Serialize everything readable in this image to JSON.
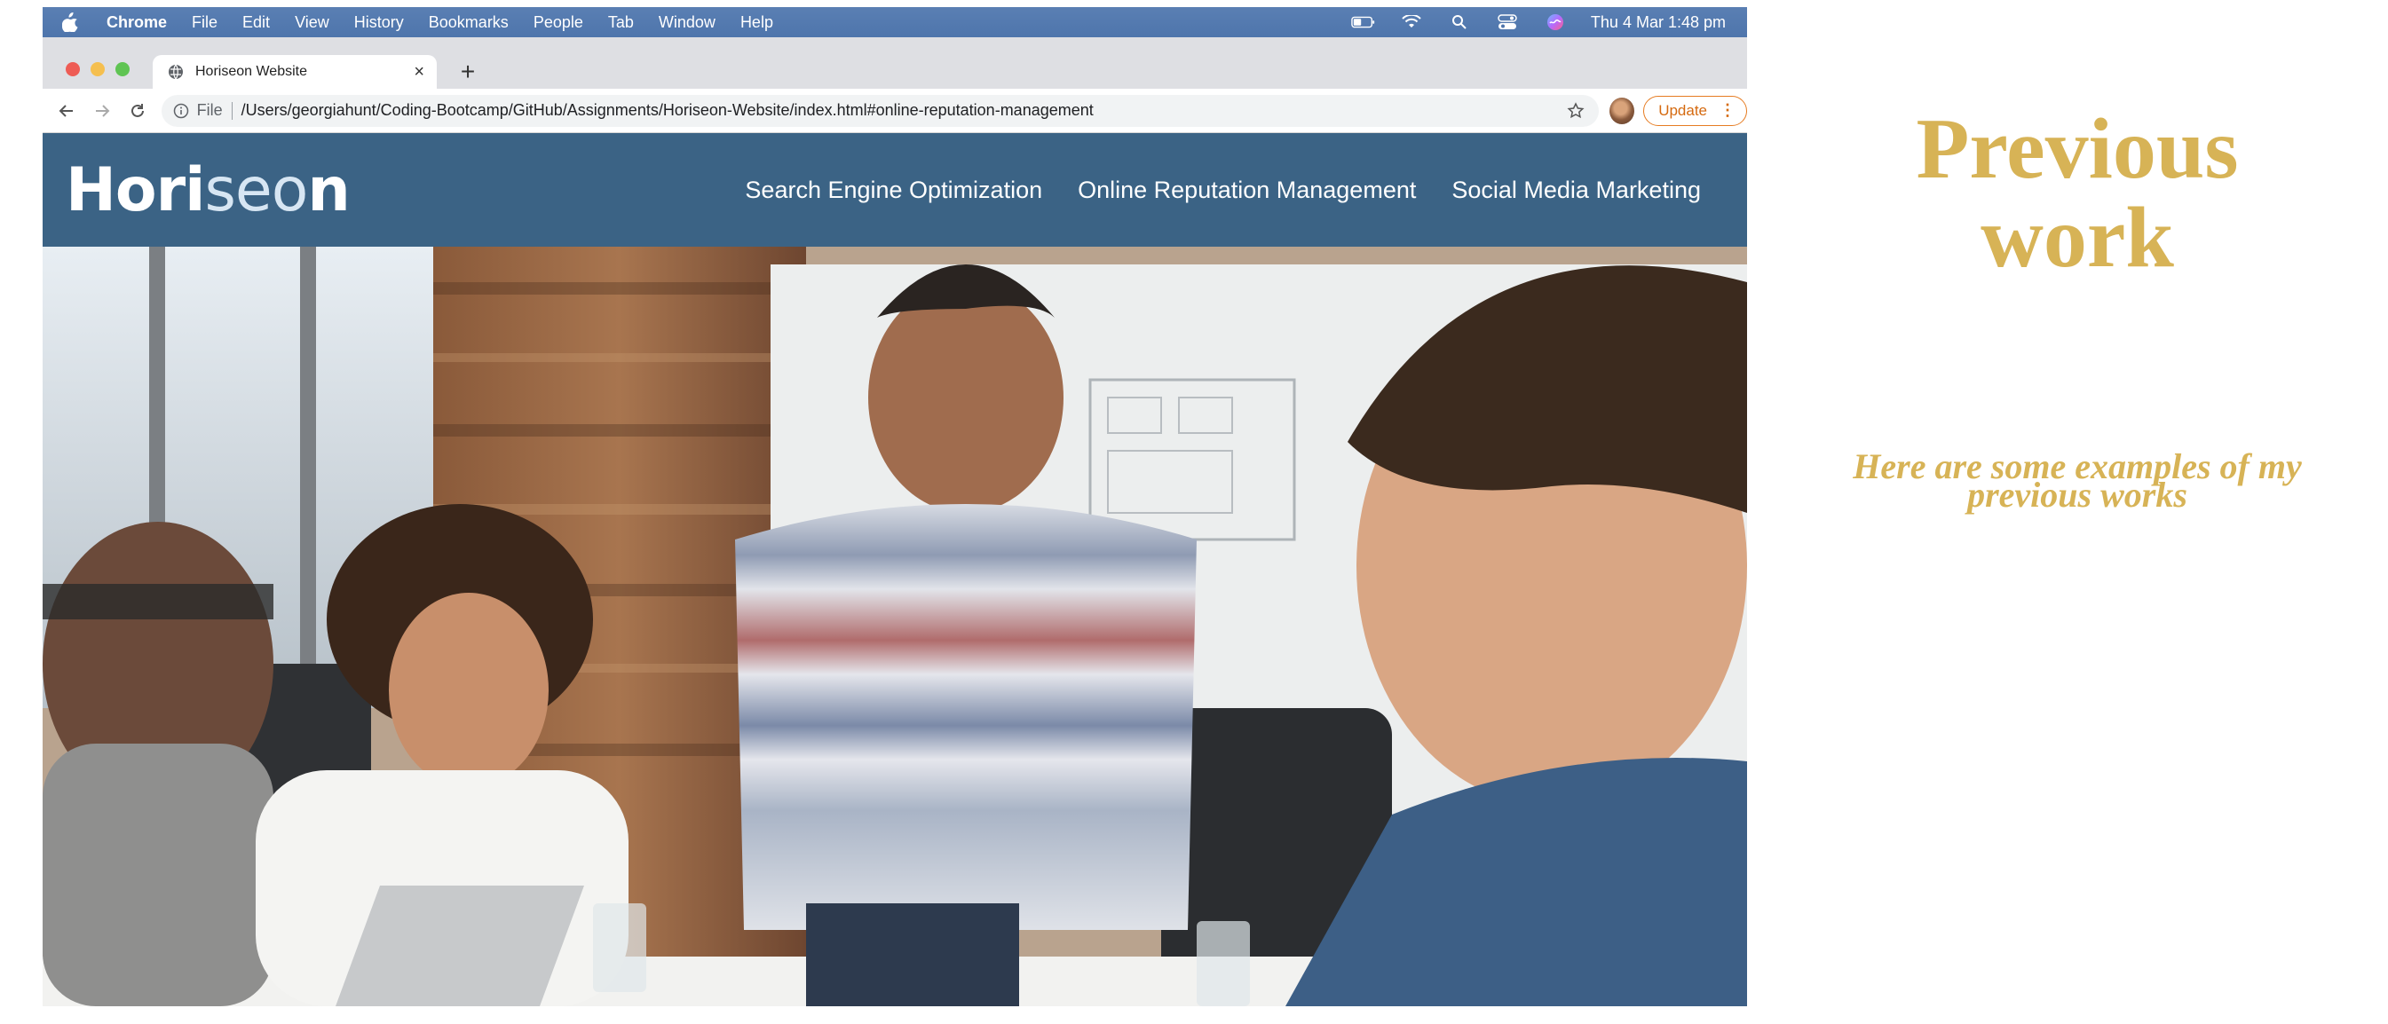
{
  "menubar": {
    "app_name": "Chrome",
    "items": [
      "File",
      "Edit",
      "View",
      "History",
      "Bookmarks",
      "People",
      "Tab",
      "Window",
      "Help"
    ],
    "clock": "Thu 4 Mar  1:48 pm",
    "status_icons": [
      "battery-icon",
      "wifi-icon",
      "spotlight-search-icon",
      "control-center-icon",
      "siri-icon"
    ]
  },
  "browser": {
    "tab_title": "Horiseon Website",
    "tab_close": "×",
    "new_tab": "+",
    "scheme_label": "File",
    "url": "/Users/georgiahunt/Coding-Bootcamp/GitHub/Assignments/Horiseon-Website/index.html#online-reputation-management",
    "update_label": "Update",
    "update_menu": "⋮"
  },
  "site": {
    "logo_main": "Hori",
    "logo_accent": "seo",
    "logo_end": "n",
    "nav": [
      "Search Engine Optimization",
      "Online Reputation Management",
      "Social Media Marketing"
    ],
    "header_color": "#3b6385"
  },
  "side": {
    "title_line1": "Previous",
    "title_line2": "work",
    "subtitle": "Here are some examples of my previous works",
    "accent_color": "#d7b356"
  }
}
